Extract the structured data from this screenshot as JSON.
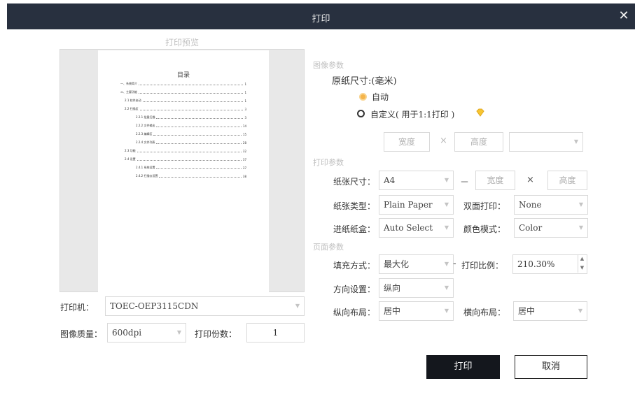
{
  "window": {
    "title": "打印",
    "close_glyph": "✕"
  },
  "preview": {
    "label": "打印预览",
    "toc_title": "目录",
    "toc": [
      {
        "text": "一、系统简介",
        "page": "1"
      },
      {
        "text": "二、主要功能",
        "page": "1"
      },
      {
        "text": "2.1 软件启动",
        "page": "1"
      },
      {
        "text": "2.2 扫描区",
        "page": "3"
      },
      {
        "text": "2.2.1 批量扫描",
        "page": "3"
      },
      {
        "text": "2.2.2 文件输出",
        "page": "14"
      },
      {
        "text": "2.2.3 编辑区",
        "page": "15"
      },
      {
        "text": "2.2.4 文件列表",
        "page": "28"
      },
      {
        "text": "2.3 功能",
        "page": "32"
      },
      {
        "text": "2.4 设置",
        "page": "37"
      },
      {
        "text": "2.4.1 系统设置",
        "page": "37"
      },
      {
        "text": "2.4.2 扫描仪设置",
        "page": "38"
      }
    ]
  },
  "printer": {
    "label": "打印机：",
    "value": "TOEC-OEP3115CDN"
  },
  "quality": {
    "label": "图像质量：",
    "value": "600dpi"
  },
  "copies": {
    "label": "打印份数：",
    "value": "1"
  },
  "image_params": {
    "section": "图像参数",
    "original_size_label": "原纸尺寸:(毫米)",
    "auto_label": "自动",
    "custom_label": "自定义( 用于1:1打印 )",
    "width_placeholder": "宽度",
    "height_placeholder": "高度",
    "unit_placeholder": "",
    "times": "×"
  },
  "print_params": {
    "section": "打印参数",
    "paper_size_label": "纸张尺寸：",
    "paper_size_value": "A4",
    "dash": "－",
    "width_placeholder": "宽度",
    "height_placeholder": "高度",
    "times": "×",
    "paper_type_label": "纸张类型：",
    "paper_type_value": "Plain Paper",
    "duplex_label": "双面打印：",
    "duplex_value": "None",
    "tray_label": "进纸纸盒：",
    "tray_value": "Auto Select",
    "color_mode_label": "颜色模式：",
    "color_mode_value": "Color"
  },
  "page_params": {
    "section": "页面参数",
    "fill_label": "填充方式：",
    "fill_value": "最大化",
    "dash": "-",
    "scale_label": "打印比例：",
    "scale_value": "210.30%",
    "orientation_label": "方向设置：",
    "orientation_value": "纵向",
    "vlayout_label": "纵向布局：",
    "vlayout_value": "居中",
    "hlayout_label": "横向布局：",
    "hlayout_value": "居中"
  },
  "buttons": {
    "print": "打印",
    "cancel": "取消"
  },
  "colors": {
    "titlebar": "#28303f",
    "radio_selected": "#f5b44a",
    "primary_button": "#14171d"
  },
  "icons": {
    "dropdown": "dropdown-arrow-icon",
    "close": "close-icon",
    "hint": "diamond-hint-icon"
  }
}
